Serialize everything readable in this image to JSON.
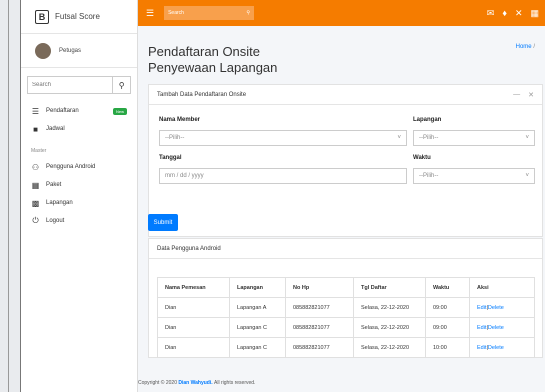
{
  "brand": {
    "logo": "B",
    "name": "Futsal Score"
  },
  "user": {
    "name": "Petugas"
  },
  "sidebar": {
    "search_placeholder": "Search",
    "items": [
      {
        "label": "Pendaftaran",
        "icon": "list-icon",
        "badge": "New"
      },
      {
        "label": "Jadwal",
        "icon": "book-icon"
      }
    ],
    "header": "Master",
    "master_items": [
      {
        "label": "Pengguna Android",
        "icon": "user-icon"
      },
      {
        "label": "Paket",
        "icon": "calendar-icon"
      },
      {
        "label": "Lapangan",
        "icon": "image-icon"
      },
      {
        "label": "Logout",
        "icon": "power-icon"
      }
    ]
  },
  "topbar": {
    "search_placeholder": "Search"
  },
  "page": {
    "title": "Pendaftaran Onsite Penyewaan Lapangan",
    "breadcrumb_home": "Home",
    "breadcrumb_sep": "/"
  },
  "form_card": {
    "title": "Tambah Data Pendaftaran Onsite",
    "member_label": "Nama Member",
    "member_value": "--Pilih--",
    "lapangan_label": "Lapangan",
    "lapangan_value": "--Pilih--",
    "tanggal_label": "Tanggal",
    "tanggal_placeholder": "mm / dd / yyyy",
    "waktu_label": "Waktu",
    "waktu_value": "--Pilih--"
  },
  "submit_label": "Submit",
  "table_card": {
    "title": "Data Pengguna Android",
    "headers": [
      "Nama Pemesan",
      "Lapangan",
      "No Hp",
      "Tgl Daftar",
      "Waktu",
      "Aksi"
    ],
    "rows": [
      [
        "Dian",
        "Lapangan A",
        "085882821077",
        "Selasa, 22-12-2020",
        "09:00"
      ],
      [
        "Dian",
        "Lapangan C",
        "085882821077",
        "Selasa, 22-12-2020",
        "09:00"
      ],
      [
        "Dian",
        "Lapangan C",
        "085882821077",
        "Selasa, 22-12-2020",
        "10:00"
      ]
    ],
    "edit_label": "Edit",
    "delete_label": "Delete",
    "sep": "|"
  },
  "footer": {
    "prefix": "Copyright © 2020",
    "author": "Dian Wahyudi.",
    "suffix": "All rights reserved."
  }
}
